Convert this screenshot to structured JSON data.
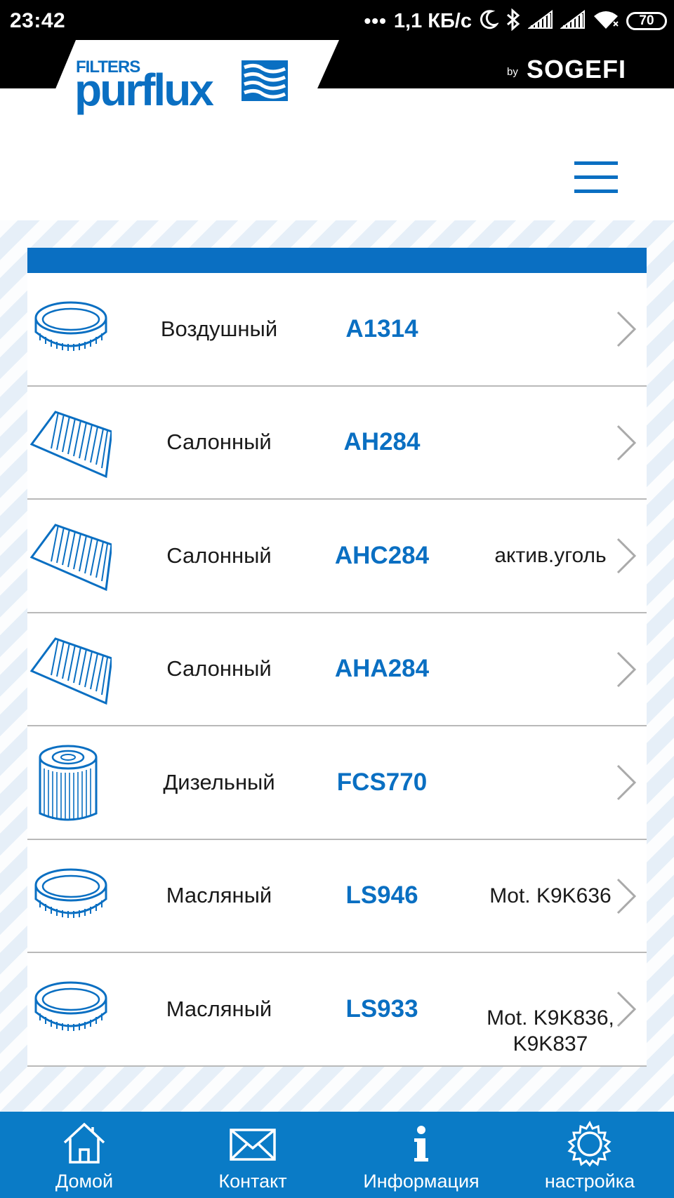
{
  "status_bar": {
    "time": "23:42",
    "network_speed": "1,1 КБ/с",
    "battery": "70",
    "icons": [
      "dots-icon",
      "moon-icon",
      "bluetooth-icon",
      "signal-icon",
      "signal-icon",
      "wifi-icon",
      "battery-icon"
    ]
  },
  "header": {
    "logo_top": "FILTERS",
    "logo_main": "purflux",
    "by_label": "by",
    "partner": "SOGEFI"
  },
  "colors": {
    "accent": "#0a6fc2",
    "nav_bg": "#0a7bc6",
    "divider": "#b9b9b9"
  },
  "filters": [
    {
      "type": "Воздушный",
      "code": "A1314",
      "note": "",
      "icon": "ring-filter-icon"
    },
    {
      "type": "Салонный",
      "code": "AH284",
      "note": "",
      "icon": "panel-filter-icon"
    },
    {
      "type": "Салонный",
      "code": "AHC284",
      "note": "актив.уголь",
      "icon": "panel-filter-icon"
    },
    {
      "type": "Салонный",
      "code": "AHA284",
      "note": "",
      "icon": "panel-filter-icon"
    },
    {
      "type": "Дизельный",
      "code": "FCS770",
      "note": "",
      "icon": "cartridge-filter-icon"
    },
    {
      "type": "Масляный",
      "code": "LS946",
      "note": "Mot. K9K636",
      "icon": "ring-filter-icon"
    },
    {
      "type": "Масляный",
      "code": "LS933",
      "note": "Mot. K9K836,\nK9K837",
      "icon": "ring-filter-icon"
    }
  ],
  "nav": [
    {
      "label": "Домой",
      "icon": "home-icon"
    },
    {
      "label": "Контакт",
      "icon": "mail-icon"
    },
    {
      "label": "Информация",
      "icon": "info-icon"
    },
    {
      "label": "настройка",
      "icon": "gear-icon"
    }
  ]
}
